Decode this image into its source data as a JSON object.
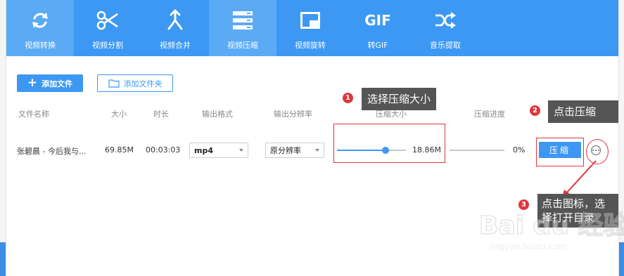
{
  "toolbar": {
    "items": [
      {
        "label": "视频转换",
        "icon": "refresh-icon",
        "active": true
      },
      {
        "label": "视频分割",
        "icon": "scissors-icon",
        "active": false
      },
      {
        "label": "视频合并",
        "icon": "merge-icon",
        "active": false
      },
      {
        "label": "视频压缩",
        "icon": "compress-icon",
        "active": true
      },
      {
        "label": "视频旋转",
        "icon": "rotate-icon",
        "active": false
      },
      {
        "label": "转GIF",
        "icon": "gif-icon",
        "active": false
      },
      {
        "label": "音乐提取",
        "icon": "shuffle-icon",
        "active": false
      }
    ],
    "gif_text": "GIF"
  },
  "actions": {
    "add_file": "添加文件",
    "add_folder": "添加文件夹"
  },
  "table": {
    "headers": {
      "name": "文件名称",
      "size": "大小",
      "duration": "时长",
      "format": "输出格式",
      "resolution": "输出分辨率",
      "compress_size": "压缩大小",
      "progress": "压缩进度"
    },
    "row": {
      "name": "张碧晨 - 今后我与...",
      "size": "69.85M",
      "duration": "00:03:03",
      "format": "mp4",
      "resolution": "原分辨率",
      "target_size": "18.86M",
      "slider_level": 0.7,
      "progress_text": "0%",
      "progress_value": 0,
      "compress_button": "压缩"
    }
  },
  "annotations": {
    "tip1": {
      "num": "1",
      "text": "选择压缩大小"
    },
    "tip2": {
      "num": "2",
      "text": "点击压缩"
    },
    "tip3": {
      "num": "3",
      "line1": "点击图标，选",
      "line2": "择打开目录"
    }
  },
  "watermark": {
    "brand": "Bai du 经验",
    "url": "jingyan.baidu.com"
  },
  "colors": {
    "accent": "#3c98f3",
    "active_tab": "#5aaaf6",
    "annotation_red": "#e0353a",
    "tip_background": "#555555"
  }
}
